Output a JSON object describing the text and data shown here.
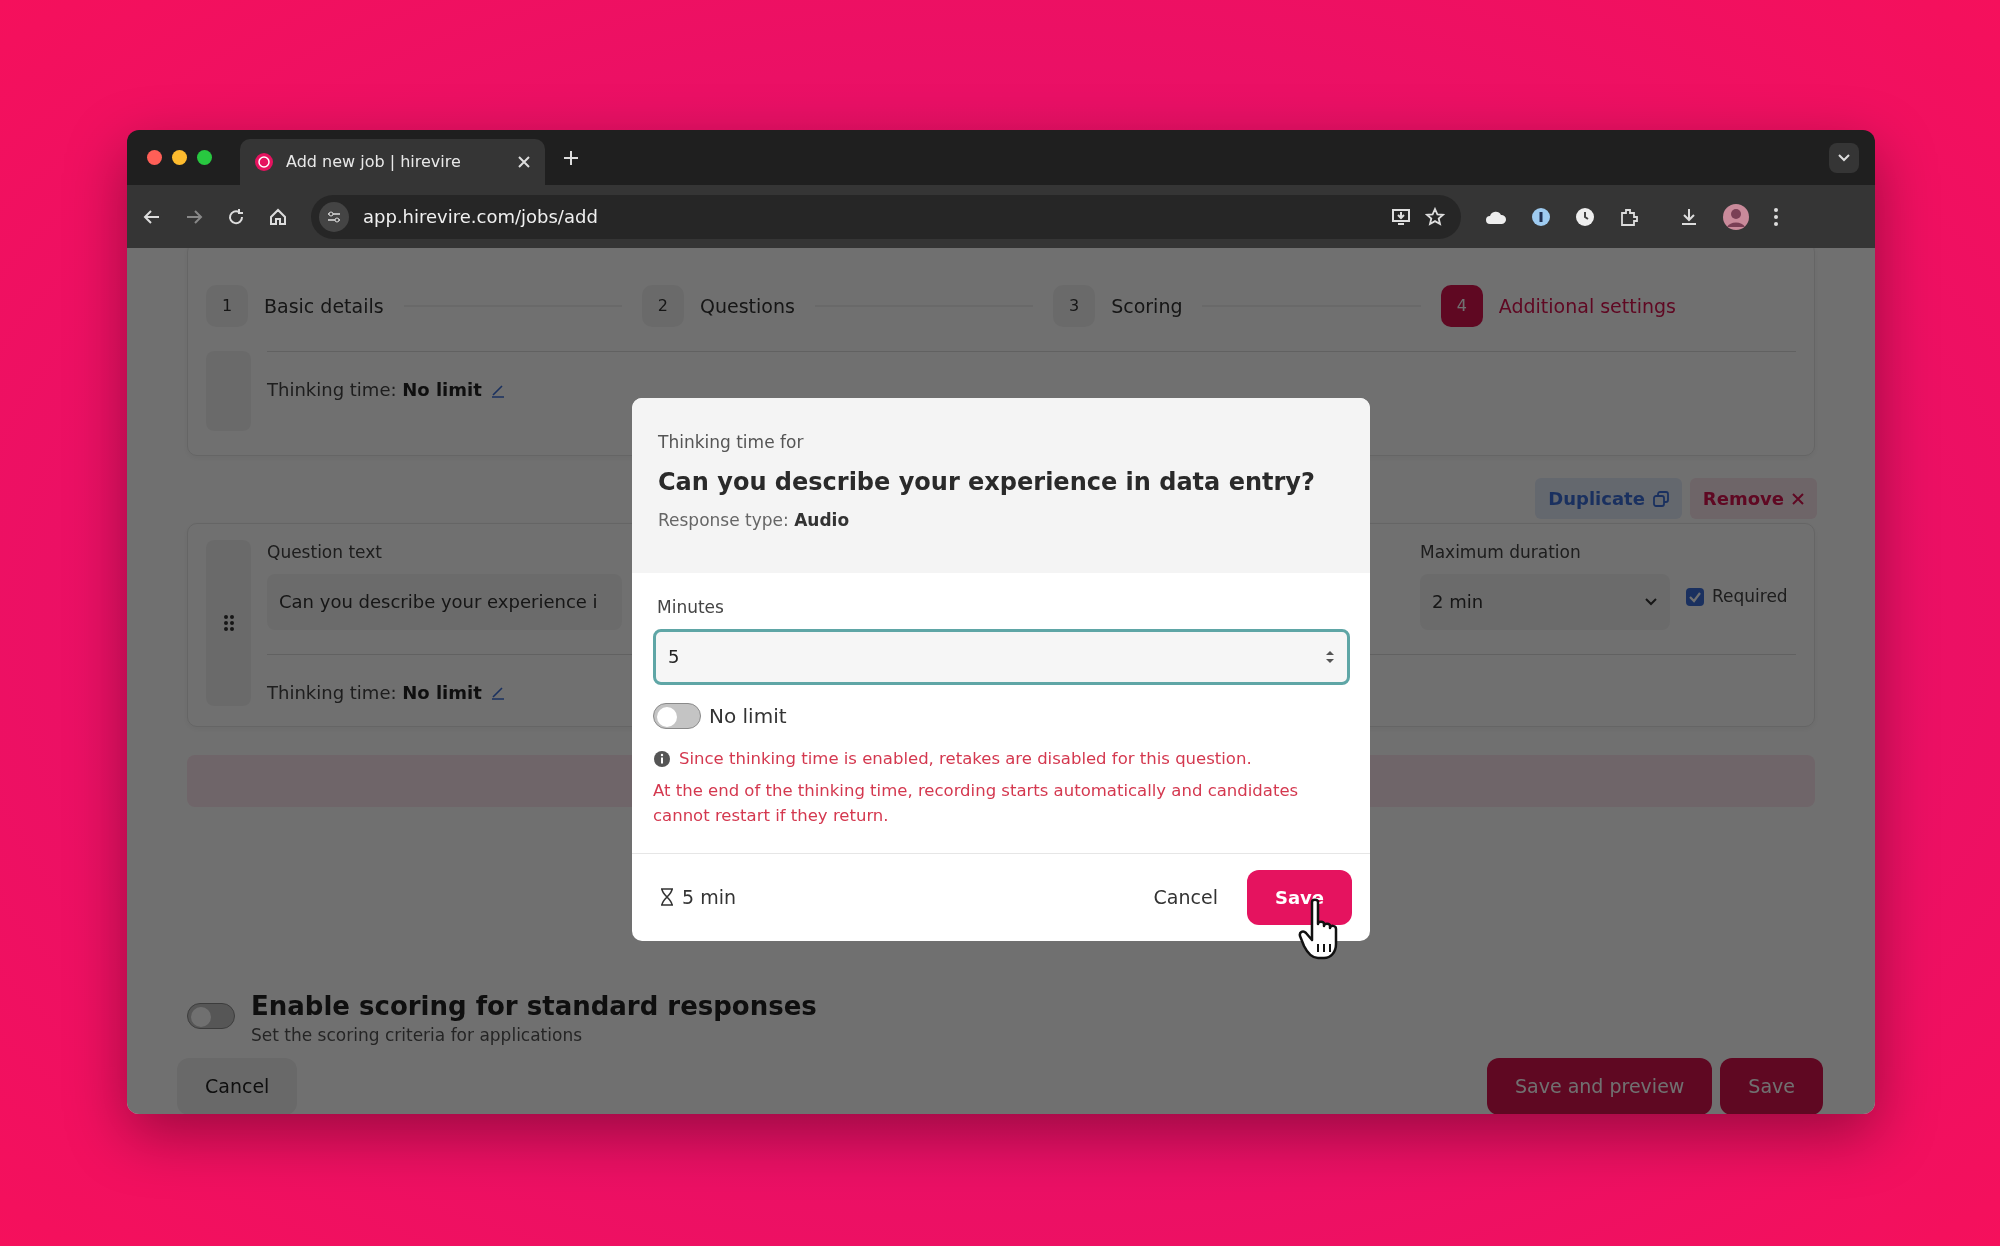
{
  "browser": {
    "tab_title": "Add new job | hirevire",
    "url": "app.hirevire.com/jobs/add"
  },
  "steps": [
    {
      "number": "1",
      "label": "Basic details",
      "selected": false
    },
    {
      "number": "2",
      "label": "Questions",
      "selected": false
    },
    {
      "number": "3",
      "label": "Scoring",
      "selected": false
    },
    {
      "number": "4",
      "label": "Additional settings",
      "selected": true
    }
  ],
  "question_card_1": {
    "thinking_time_label": "Thinking time:",
    "thinking_time_value": "No limit"
  },
  "question_card_2": {
    "duplicate": "Duplicate",
    "remove": "Remove",
    "question_label": "Question text",
    "question_value": "Can you describe your experience i",
    "max_duration_label": "Maximum duration",
    "max_duration_value": "2 min",
    "required": {
      "label": "Required",
      "checked": true
    },
    "thinking_time_label": "Thinking time:",
    "thinking_time_value": "No limit"
  },
  "scoring": {
    "title": "Enable scoring for standard responses",
    "subtitle": "Set the scoring criteria for applications",
    "on": false
  },
  "footer": {
    "cancel": "Cancel",
    "save_and_preview": "Save and preview",
    "save": "Save"
  },
  "modal": {
    "eyebrow": "Thinking time for",
    "title": "Can you describe your experience in data entry?",
    "response_type_label": "Response type:",
    "response_type_value": "Audio",
    "minutes_label": "Minutes",
    "minutes_value": "5",
    "no_limit": {
      "label": "No limit",
      "on": false
    },
    "info": "Since thinking time is enabled, retakes are disabled for this question.",
    "warning": "At the end of the thinking time, recording starts automatically and candidates cannot restart if they return.",
    "summary": "5 min",
    "cancel": "Cancel",
    "save": "Save"
  }
}
